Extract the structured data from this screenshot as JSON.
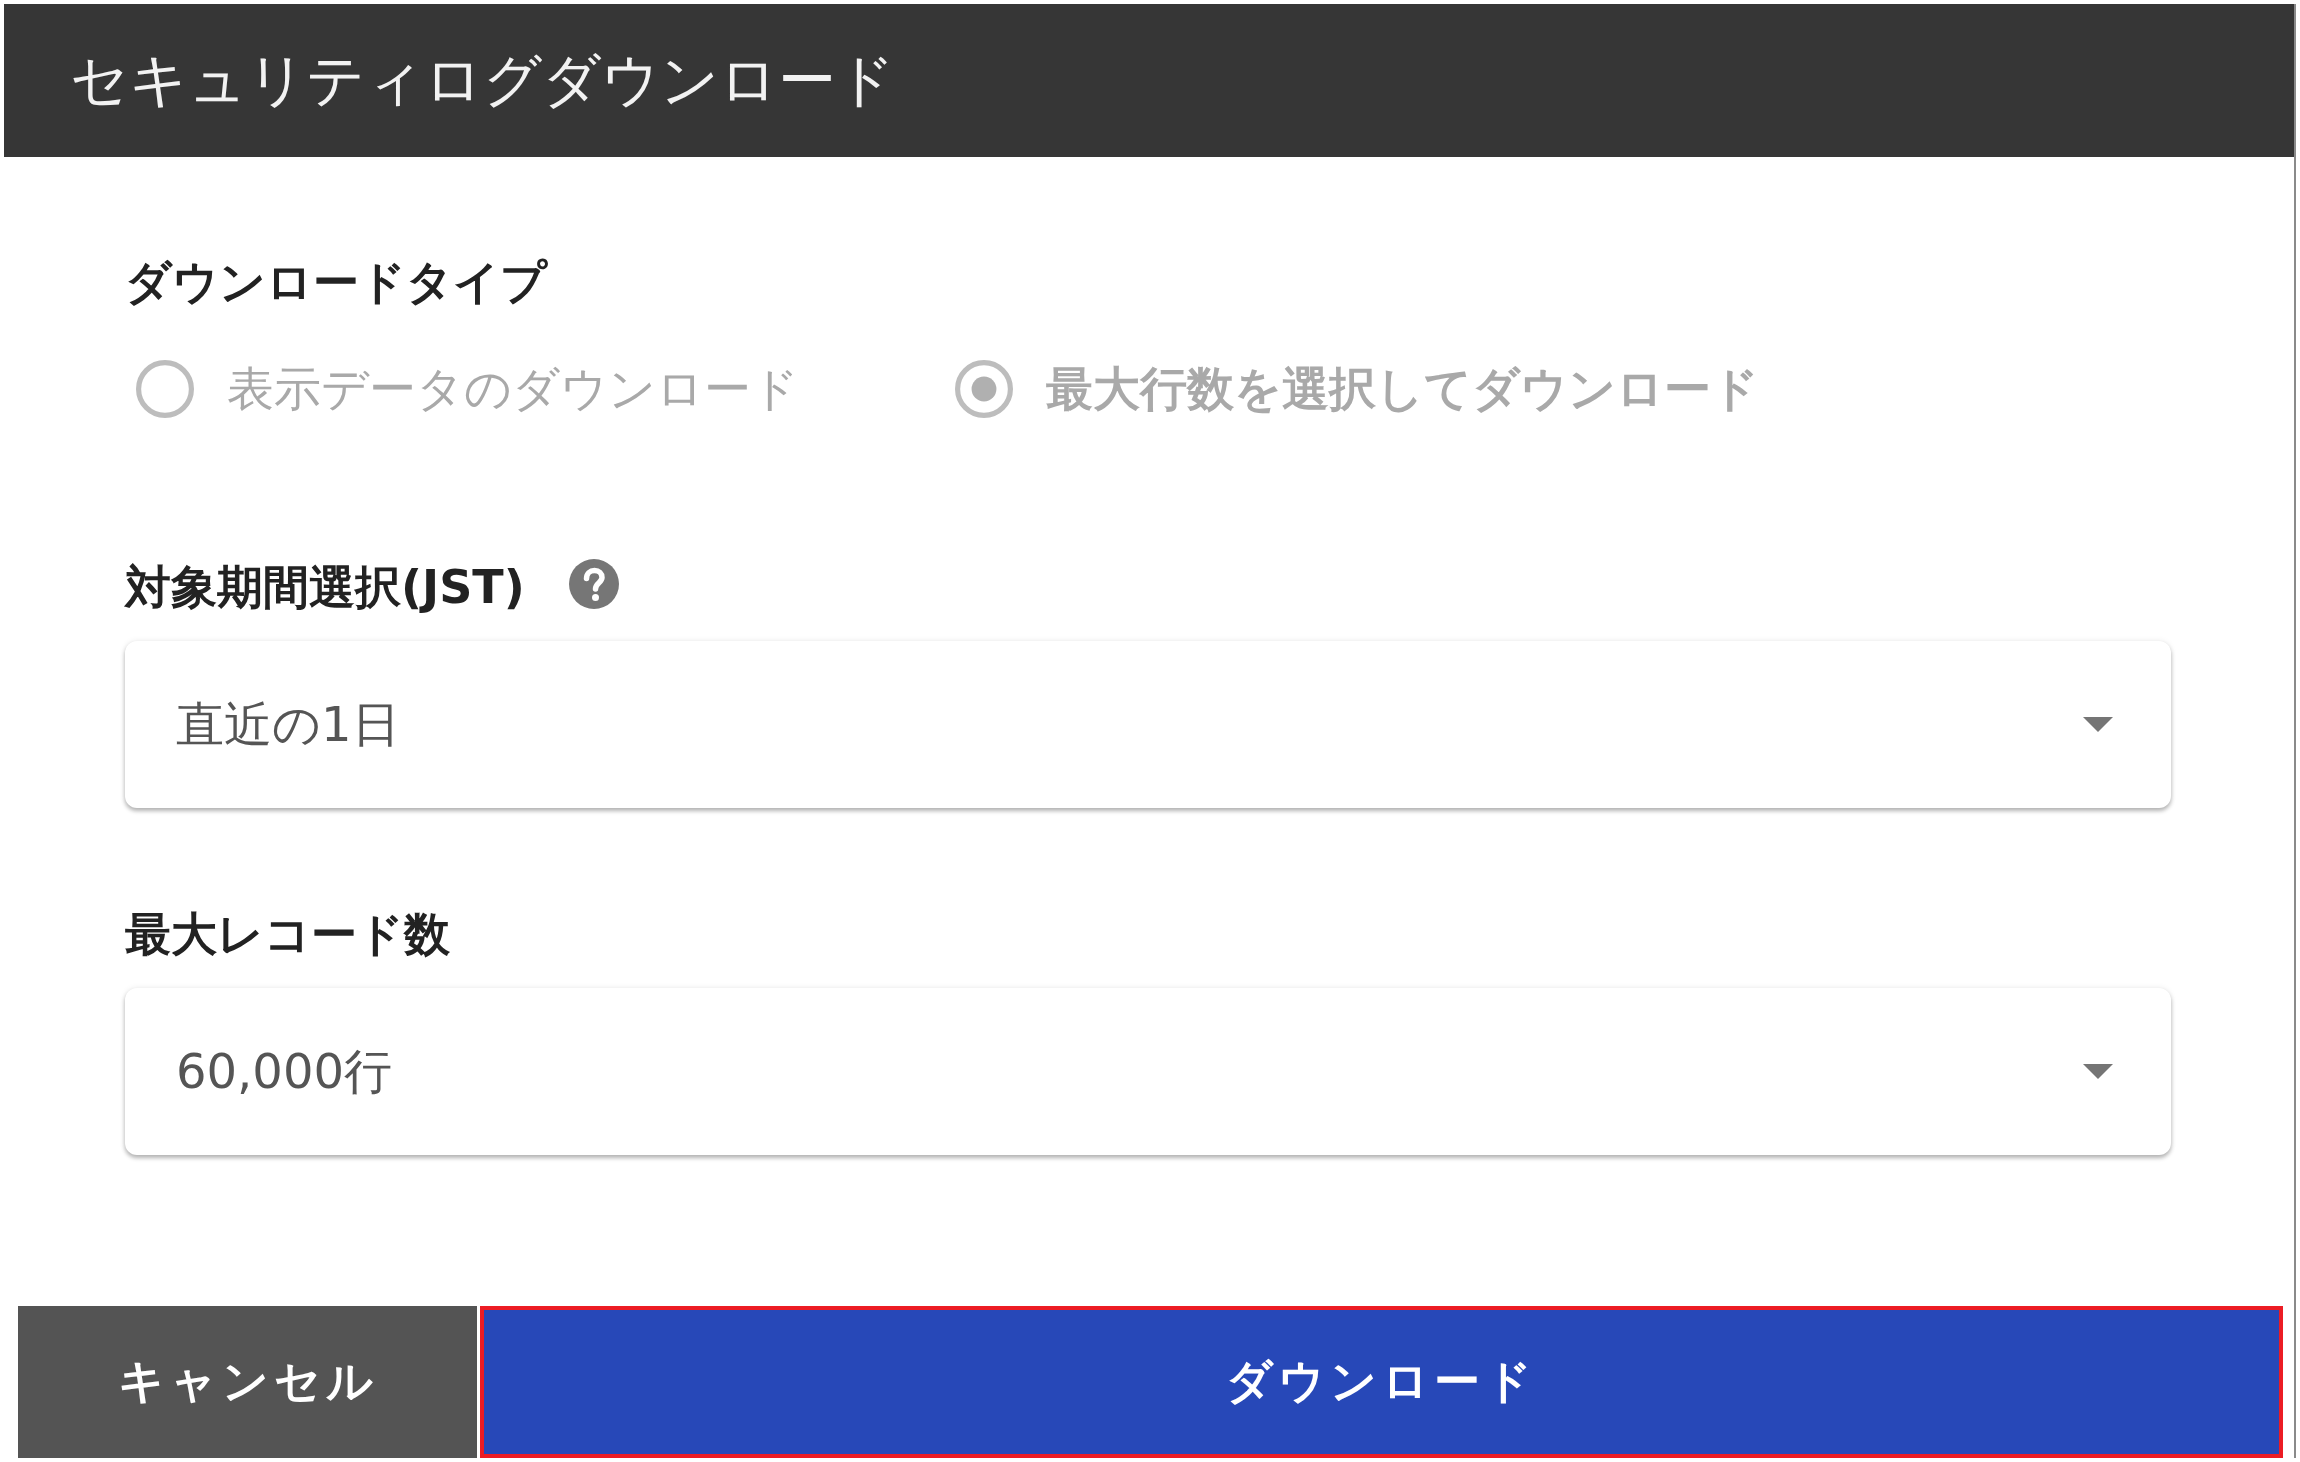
{
  "dialog": {
    "title": "セキュリティログダウンロード"
  },
  "download_type": {
    "label": "ダウンロードタイプ",
    "disabled": true,
    "options": [
      {
        "label": "表示データのダウンロード",
        "selected": false
      },
      {
        "label": "最大行数を選択してダウンロード",
        "selected": true
      }
    ]
  },
  "fields": [
    {
      "label": "対象期間選択(JST)",
      "help": true,
      "value": "直近の1日"
    },
    {
      "label": "最大レコード数",
      "value": "60,000行"
    }
  ],
  "buttons": [
    {
      "label": "キャンセル",
      "kind": "secondary",
      "highlighted": false
    },
    {
      "label": "ダウンロード",
      "kind": "primary",
      "highlighted": true
    }
  ]
}
